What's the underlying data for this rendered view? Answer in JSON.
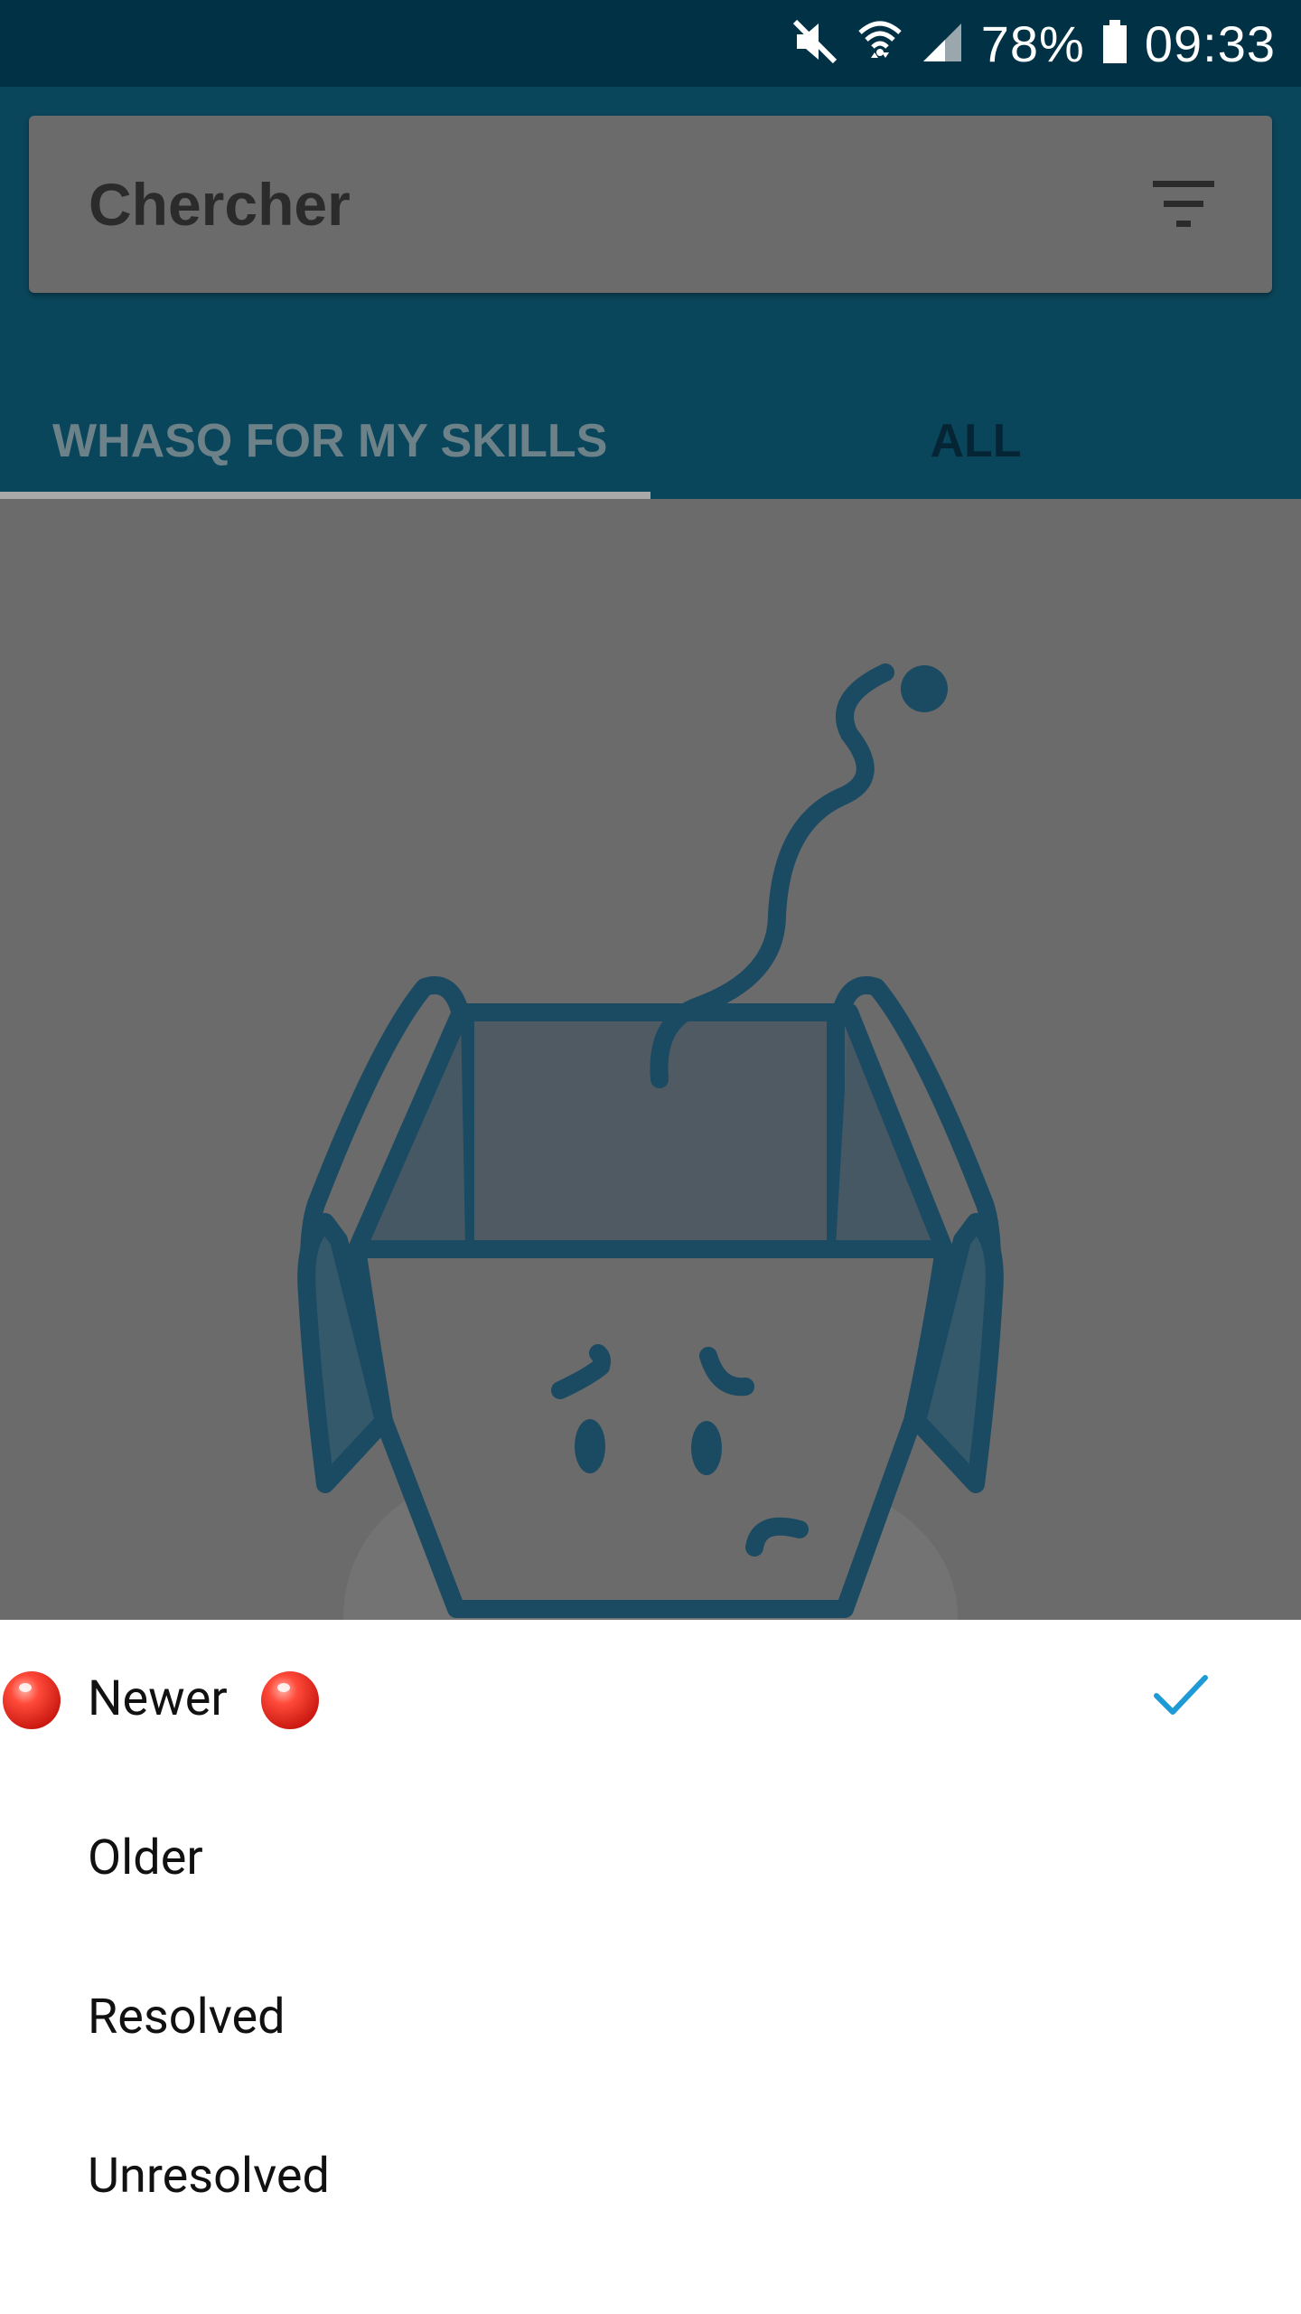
{
  "status_bar": {
    "battery_percent": "78%",
    "time": "09:33",
    "icons": [
      "mute-icon",
      "wifi-icon",
      "signal-icon",
      "battery-icon"
    ]
  },
  "search": {
    "placeholder": "Chercher",
    "filter_icon": "filter-icon"
  },
  "tabs": [
    {
      "label": "WHASQ FOR MY SKILLS",
      "selected": true
    },
    {
      "label": "ALL",
      "selected": false
    }
  ],
  "empty_state": {
    "illustration": "sad-open-box-illustration"
  },
  "sort_sheet": {
    "options": [
      {
        "label": "Newer",
        "selected": true,
        "badge": "red-dot-icon"
      },
      {
        "label": "Older",
        "selected": false
      },
      {
        "label": "Resolved",
        "selected": false
      },
      {
        "label": "Unresolved",
        "selected": false
      }
    ],
    "check_icon": "check-icon"
  },
  "colors": {
    "status_bar": "#013145",
    "app_bar": "#0a465b",
    "scrim": "#6b6b6b",
    "illustration_stroke": "#1b4a63",
    "check": "#1e9bd7",
    "badge": "#e8281e"
  }
}
